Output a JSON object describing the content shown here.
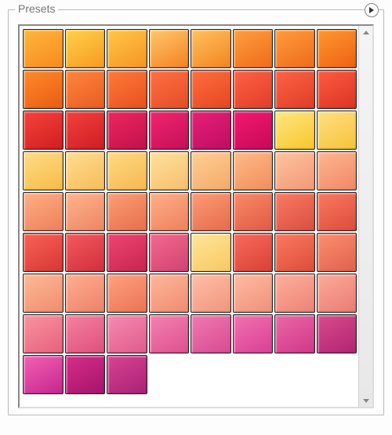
{
  "panel": {
    "title": "Presets"
  },
  "grid": {
    "columns": 8,
    "swatches": [
      {
        "c1": "#ffb63d",
        "c2": "#f78a1f"
      },
      {
        "c1": "#ffd24a",
        "c2": "#f79a22"
      },
      {
        "c1": "#ffc74a",
        "c2": "#f6951f"
      },
      {
        "c1": "#ffc96c",
        "c2": "#f38121"
      },
      {
        "c1": "#ffc260",
        "c2": "#f38421"
      },
      {
        "c1": "#ff9f3f",
        "c2": "#f06b1a"
      },
      {
        "c1": "#ff9d3e",
        "c2": "#ef6a1a"
      },
      {
        "c1": "#ff9930",
        "c2": "#ef6012"
      },
      {
        "c1": "#ff8b2a",
        "c2": "#e95c14"
      },
      {
        "c1": "#ff873c",
        "c2": "#e85c22"
      },
      {
        "c1": "#ff7b3a",
        "c2": "#e7501f"
      },
      {
        "c1": "#ff7142",
        "c2": "#e54c27"
      },
      {
        "c1": "#ff6e3f",
        "c2": "#e44721"
      },
      {
        "c1": "#ff6244",
        "c2": "#df3e28"
      },
      {
        "c1": "#ff6344",
        "c2": "#de3d27"
      },
      {
        "c1": "#ff5b42",
        "c2": "#db3424"
      },
      {
        "c1": "#f6433a",
        "c2": "#d01e22"
      },
      {
        "c1": "#f5403c",
        "c2": "#ce1d25"
      },
      {
        "c1": "#ec2760",
        "c2": "#c3114a"
      },
      {
        "c1": "#f0256e",
        "c2": "#c61059"
      },
      {
        "c1": "#e81f78",
        "c2": "#bf0d63"
      },
      {
        "c1": "#f21a70",
        "c2": "#c80958"
      },
      {
        "c1": "#ffe780",
        "c2": "#f7c62e"
      },
      {
        "c1": "#ffe084",
        "c2": "#f6c23a"
      },
      {
        "c1": "#ffdc88",
        "c2": "#f6bc46"
      },
      {
        "c1": "#ffdd92",
        "c2": "#f6bc58"
      },
      {
        "c1": "#ffdb82",
        "c2": "#f6b750"
      },
      {
        "c1": "#ffe29c",
        "c2": "#f6be6e"
      },
      {
        "c1": "#ffcf93",
        "c2": "#f3aa6a"
      },
      {
        "c1": "#ffbb89",
        "c2": "#f08e5c"
      },
      {
        "c1": "#ffc49f",
        "c2": "#f19876"
      },
      {
        "c1": "#ffb791",
        "c2": "#ef8866"
      },
      {
        "c1": "#ffb085",
        "c2": "#ee7f59"
      },
      {
        "c1": "#ffb58f",
        "c2": "#ef8462"
      },
      {
        "c1": "#fe9f77",
        "c2": "#e66e4b"
      },
      {
        "c1": "#ffb089",
        "c2": "#ee805c"
      },
      {
        "c1": "#fe9c75",
        "c2": "#e46c4b"
      },
      {
        "c1": "#fc8a69",
        "c2": "#df5b42"
      },
      {
        "c1": "#fa7c63",
        "c2": "#da4e3f"
      },
      {
        "c1": "#fb7a60",
        "c2": "#db4c3c"
      },
      {
        "c1": "#fa6256",
        "c2": "#d63735"
      },
      {
        "c1": "#f55a5d",
        "c2": "#d02f3c"
      },
      {
        "c1": "#ef4670",
        "c2": "#c82452"
      },
      {
        "c1": "#f36a8e",
        "c2": "#d14272"
      },
      {
        "c1": "#ffe69a",
        "c2": "#f8c862"
      },
      {
        "c1": "#fa6b5d",
        "c2": "#d94036"
      },
      {
        "c1": "#fc7a61",
        "c2": "#dc4d38"
      },
      {
        "c1": "#fd8f73",
        "c2": "#e0614a"
      },
      {
        "c1": "#ffba98",
        "c2": "#ef8d6d"
      },
      {
        "c1": "#ffaf92",
        "c2": "#ee8167"
      },
      {
        "c1": "#ffa280",
        "c2": "#eb7354"
      },
      {
        "c1": "#ffb89b",
        "c2": "#ef8b70"
      },
      {
        "c1": "#ffc0a6",
        "c2": "#f0957d"
      },
      {
        "c1": "#ffbca2",
        "c2": "#f09079"
      },
      {
        "c1": "#feb09e",
        "c2": "#ed8275"
      },
      {
        "c1": "#fcab9c",
        "c2": "#ea7c72"
      },
      {
        "c1": "#fb92a1",
        "c2": "#e6627d"
      },
      {
        "c1": "#f682a0",
        "c2": "#de507e"
      },
      {
        "c1": "#f78bae",
        "c2": "#e05b8d"
      },
      {
        "c1": "#f582b0",
        "c2": "#de508f"
      },
      {
        "c1": "#f07ab1",
        "c2": "#d84a92"
      },
      {
        "c1": "#f272b1",
        "c2": "#da3f94"
      },
      {
        "c1": "#eb68a6",
        "c2": "#d13789"
      },
      {
        "c1": "#d84c8c",
        "c2": "#b22472"
      },
      {
        "c1": "#f361b2",
        "c2": "#c6268f"
      },
      {
        "c1": "#d72d89",
        "c2": "#a6146b"
      },
      {
        "c1": "#d94392",
        "c2": "#a92275"
      }
    ]
  }
}
